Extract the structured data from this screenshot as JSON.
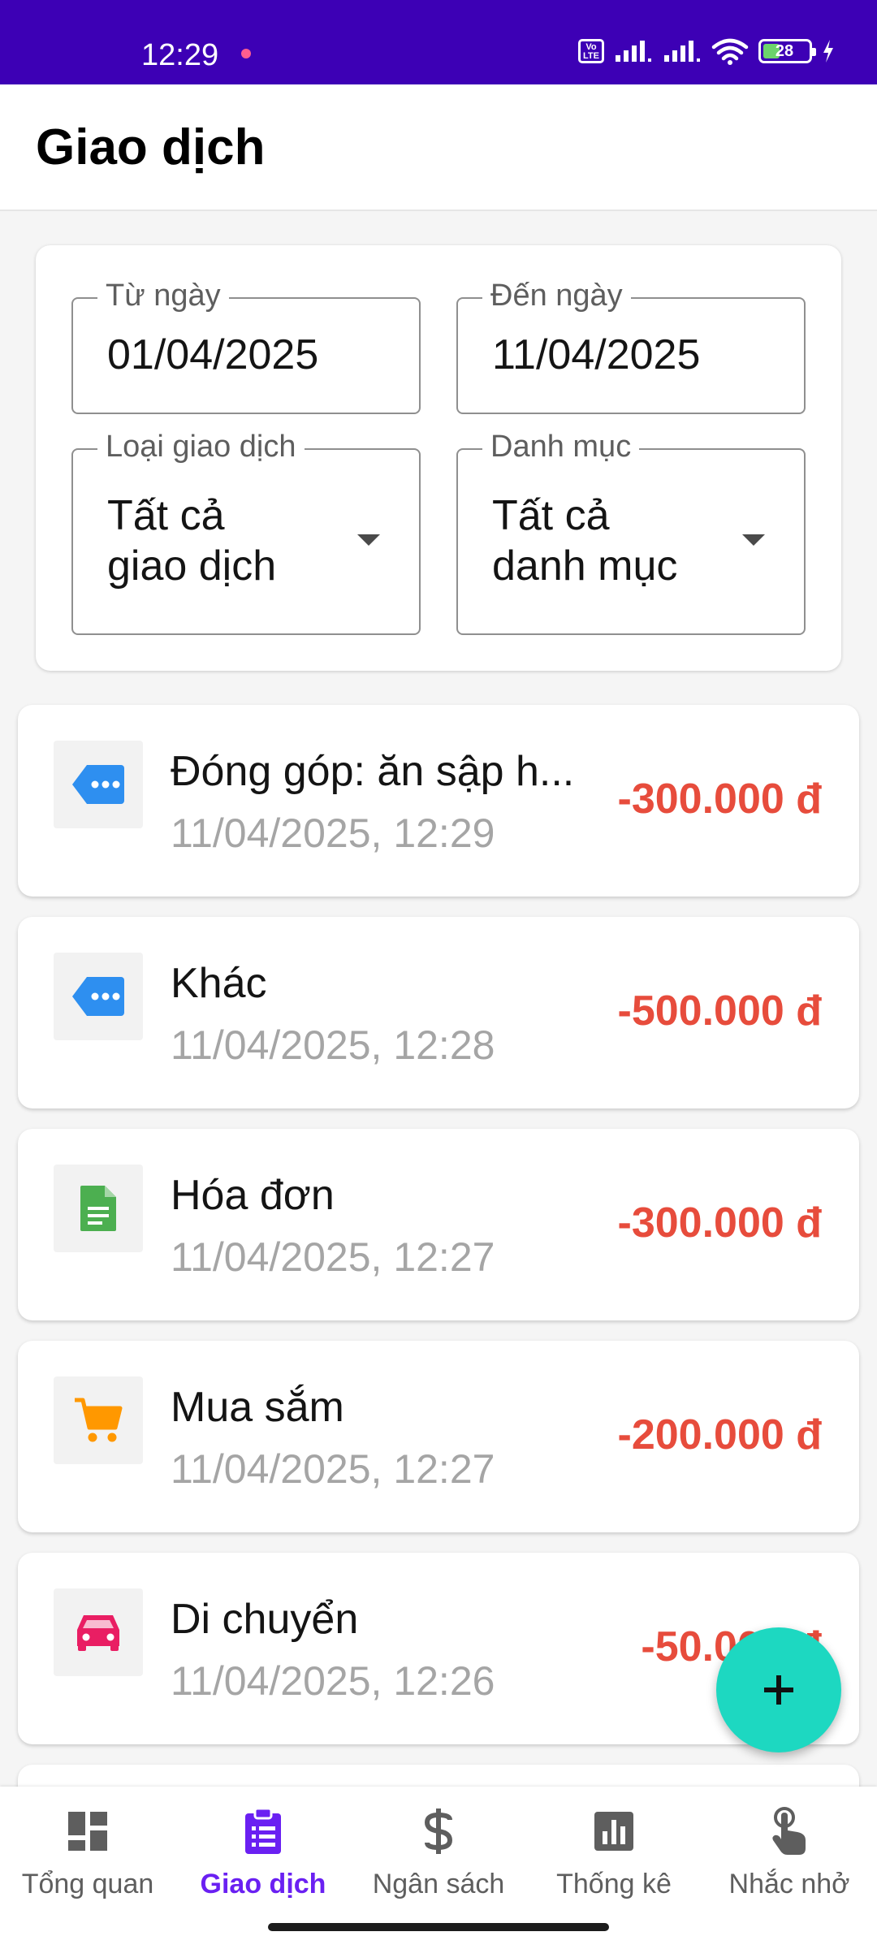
{
  "status_bar": {
    "time": "12:29",
    "network_badge": "Vo LTE",
    "battery": "28"
  },
  "header": {
    "title": "Giao dịch"
  },
  "filters": {
    "from_date": {
      "label": "Từ ngày",
      "value": "01/04/2025"
    },
    "to_date": {
      "label": "Đến ngày",
      "value": "11/04/2025"
    },
    "type": {
      "label": "Loại giao dịch",
      "value_line1": "Tất cả",
      "value_line2": "giao dịch"
    },
    "category": {
      "label": "Danh mục",
      "value_line1": "Tất cả",
      "value_line2": "danh mục"
    }
  },
  "transactions": [
    {
      "title": "Đóng góp: ăn sập h...",
      "date": "11/04/2025, 12:29",
      "amount": "-300.000 đ",
      "icon": "tag-more-icon",
      "icon_color": "#2e8ff0"
    },
    {
      "title": "Khác",
      "date": "11/04/2025, 12:28",
      "amount": "-500.000 đ",
      "icon": "tag-more-icon",
      "icon_color": "#2e8ff0"
    },
    {
      "title": "Hóa đơn",
      "date": "11/04/2025, 12:27",
      "amount": "-300.000 đ",
      "icon": "receipt-icon",
      "icon_color": "#4caf50"
    },
    {
      "title": "Mua sắm",
      "date": "11/04/2025, 12:27",
      "amount": "-200.000 đ",
      "icon": "cart-icon",
      "icon_color": "#ff9800"
    },
    {
      "title": "Di chuyển",
      "date": "11/04/2025, 12:26",
      "amount": "-50.000 đ",
      "icon": "car-icon",
      "icon_color": "#e91e63"
    }
  ],
  "fab": {
    "icon": "plus-icon",
    "color": "#1dd8c1"
  },
  "bottom_nav": [
    {
      "label": "Tổng quan",
      "icon": "dashboard-icon",
      "active": false
    },
    {
      "label": "Giao dịch",
      "icon": "clipboard-list-icon",
      "active": true
    },
    {
      "label": "Ngân sách",
      "icon": "dollar-icon",
      "active": false
    },
    {
      "label": "Thống kê",
      "icon": "bar-chart-icon",
      "active": false
    },
    {
      "label": "Nhắc nhở",
      "icon": "tap-icon",
      "active": false
    }
  ],
  "colors": {
    "status_bar": "#3d00b5",
    "accent": "#6a20f2",
    "expense": "#e74c3c"
  }
}
